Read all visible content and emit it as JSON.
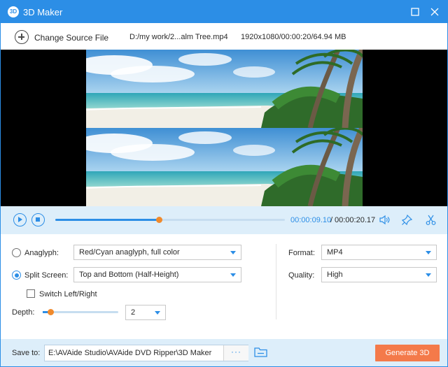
{
  "window": {
    "title": "3D Maker",
    "logo_text": "3D",
    "accent_color": "#2c8ee6",
    "controls": [
      "maximize-icon",
      "close-icon"
    ]
  },
  "source": {
    "change_label": "Change Source File",
    "file_path": "D:/my work/2...alm Tree.mp4",
    "file_info": "1920x1080/00:00:20/64.94 MB"
  },
  "playback": {
    "current_time": "00:00:09.10",
    "separator": "/",
    "total_time": "00:00:20.17",
    "progress_fraction": 0.45,
    "icons": [
      "play-icon",
      "stop-icon",
      "volume-icon",
      "pin-icon",
      "scissors-icon"
    ]
  },
  "settings": {
    "anaglyph": {
      "label": "Anaglyph:",
      "selected": false,
      "value": "Red/Cyan anaglyph, full color"
    },
    "split_screen": {
      "label": "Split Screen:",
      "selected": true,
      "value": "Top and Bottom (Half-Height)"
    },
    "switch_lr": {
      "label": "Switch Left/Right",
      "checked": false
    },
    "depth": {
      "label": "Depth:",
      "value": "2",
      "slider_fraction": 0.1
    },
    "format": {
      "label": "Format:",
      "value": "MP4"
    },
    "quality": {
      "label": "Quality:",
      "value": "High"
    }
  },
  "footer": {
    "save_label": "Save to:",
    "save_path": "E:\\AVAide Studio\\AVAide DVD Ripper\\3D Maker",
    "more_label": "···",
    "generate_label": "Generate 3D",
    "generate_color": "#f47a4a"
  }
}
